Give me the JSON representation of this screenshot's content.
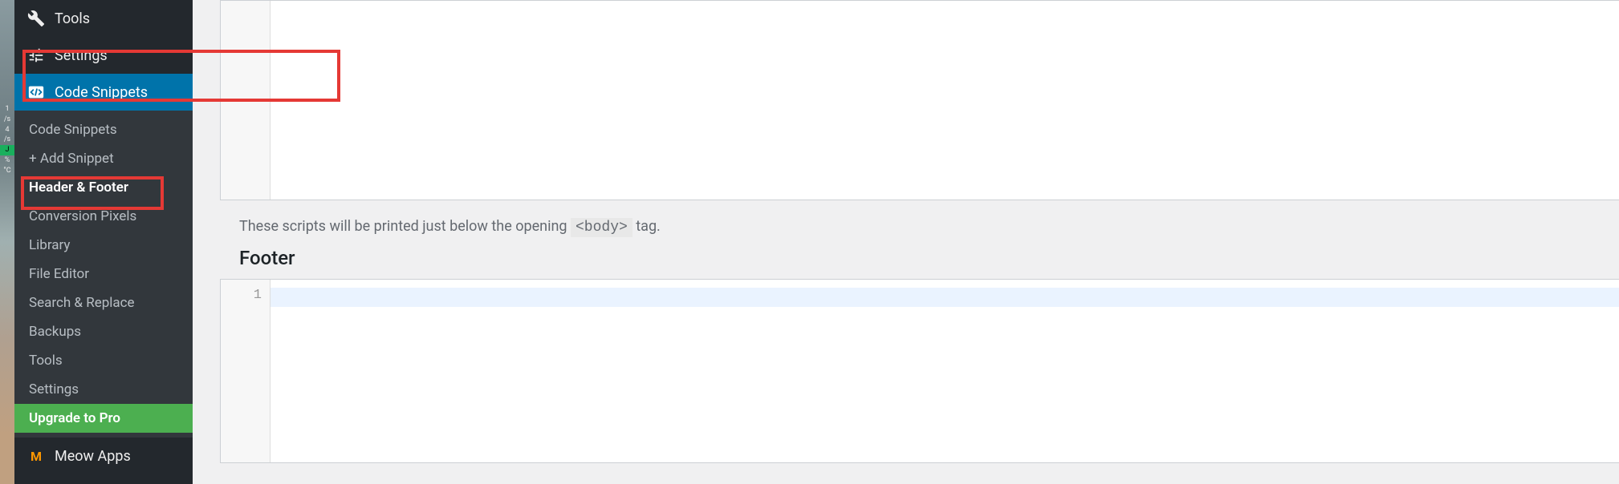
{
  "strip": {
    "l1": "1",
    "l2": "/s",
    "l3": "4",
    "l4": "/s",
    "l5": "J",
    "l6": "%",
    "l7": "°C"
  },
  "sidebar": {
    "tools": "Tools",
    "settings": "Settings",
    "code_snippets": "Code Snippets",
    "submenu": {
      "code_snippets": "Code Snippets",
      "add_snippet": "+ Add Snippet",
      "header_footer": "Header & Footer",
      "conversion_pixels": "Conversion Pixels",
      "library": "Library",
      "file_editor": "File Editor",
      "search_replace": "Search & Replace",
      "backups": "Backups",
      "tools": "Tools",
      "settings": "Settings",
      "upgrade": "Upgrade to Pro"
    },
    "meow_apps": "Meow Apps"
  },
  "main": {
    "description_prefix": "These scripts will be printed just below the opening ",
    "description_tag": "<body>",
    "description_suffix": " tag.",
    "footer_title": "Footer",
    "line_number": "1"
  }
}
